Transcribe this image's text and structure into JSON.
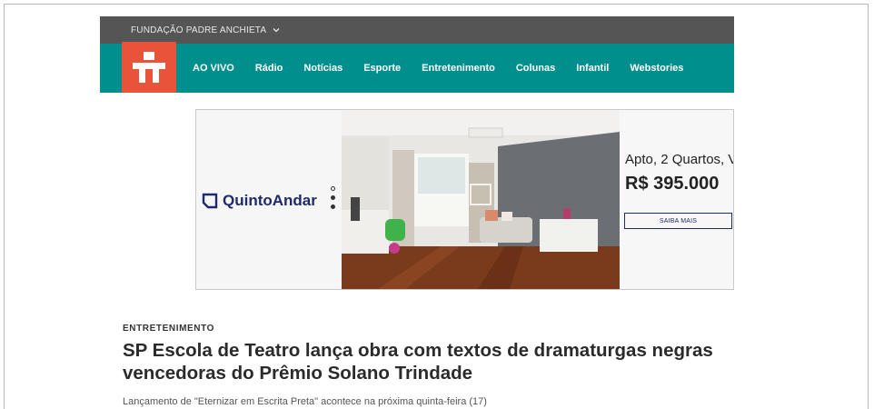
{
  "header": {
    "org_label": "FUNDAÇÃO PADRE ANCHIETA",
    "nav": [
      "AO VIVO",
      "Rádio",
      "Notícias",
      "Esporte",
      "Entretenimento",
      "Colunas",
      "Infantil",
      "Webstories"
    ]
  },
  "ad": {
    "brand": "QuintoAndar",
    "headline": "Apto, 2 Quartos, V",
    "price": "R$ 395.000",
    "cta": "SAIBA MAIS"
  },
  "article": {
    "kicker": "ENTRETENIMENTO",
    "title": "SP Escola de Teatro lança obra com textos de dramaturgas negras vencedoras do Prêmio Solano Trindade",
    "subtitle": "Lançamento de \"Eternizar em Escrita Preta\" acontece na próxima quinta-feira (17)"
  },
  "colors": {
    "topbar": "#555555",
    "navbar": "#008f8c",
    "logo": "#e8543a",
    "brand": "#1e2a6b"
  }
}
